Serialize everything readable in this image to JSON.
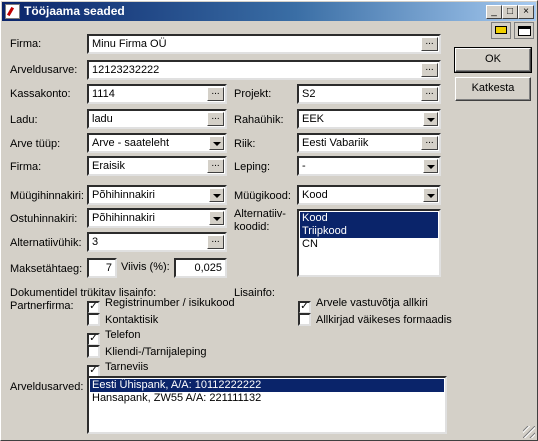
{
  "window": {
    "title": "Töö­jaama seaded"
  },
  "fields": {
    "firma": {
      "label": "Firma:",
      "value": "Minu Firma OÜ"
    },
    "arveldusarve": {
      "label": "Arveldusarve:",
      "value": "12123232222"
    },
    "kassakonto": {
      "label": "Kassakonto:",
      "value": "1114"
    },
    "projekt": {
      "label": "Projekt:",
      "value": "S2"
    },
    "ladu": {
      "label": "Ladu:",
      "value": "ladu"
    },
    "rahauhik": {
      "label": "Rahaühik:",
      "value": "EEK"
    },
    "arve_tuup": {
      "label": "Arve tüüp:",
      "value": "Arve - saateleht"
    },
    "riik": {
      "label": "Riik:",
      "value": "Eesti Vabariik"
    },
    "firma2": {
      "label": "Firma:",
      "value": "Eraisik"
    },
    "leping": {
      "label": "Leping:",
      "value": "-"
    },
    "muugihinnakiri": {
      "label": "Müügihinnakiri:",
      "value": "Põhihinnakiri"
    },
    "muugikood": {
      "label": "Müügikood:",
      "value": "Kood"
    },
    "ostuhinnakiri": {
      "label": "Ostuhinnakiri:",
      "value": "Põhihinnakiri"
    },
    "alternatiivuhik": {
      "label": "Alternatiivühik:",
      "value": "3"
    },
    "maksetahtaeg": {
      "label": "Maksetähtaeg:",
      "value": "7"
    },
    "viivis": {
      "label": "Viivis (%):",
      "value": "0,025"
    },
    "alt_koodid": {
      "label1": "Alternatiiv-",
      "label2": "koodid:",
      "items": [
        "Kood",
        "Triipkood",
        "CN"
      ]
    }
  },
  "buttons": {
    "ok": "OK",
    "katkesta": "Katkesta",
    "dots": "..."
  },
  "section": {
    "dok_title": "Dokumentidel trükitav lisainfo:",
    "partner_label": "Partnerfirma:",
    "lisainfo_label": "Lisainfo:"
  },
  "checks_left": [
    {
      "label": "Registrinumber / isikukood",
      "checked": true
    },
    {
      "label": "Kontaktisik",
      "checked": false
    },
    {
      "label": "Telefon",
      "checked": true
    },
    {
      "label": "Kliendi-/Tarnijaleping",
      "checked": false
    },
    {
      "label": "Tarneviis",
      "checked": true
    }
  ],
  "checks_right": [
    {
      "label": "Arvele vastuvõtja allkiri",
      "checked": true
    },
    {
      "label": "Allkirjad väikeses formaadis",
      "checked": false
    }
  ],
  "arveldusarved": {
    "label": "Arveldusarved:",
    "items": [
      "Eesti Ühispank, A/A: 10112222222",
      "Hansapank, ZW55 A/A: 221111132"
    ]
  }
}
